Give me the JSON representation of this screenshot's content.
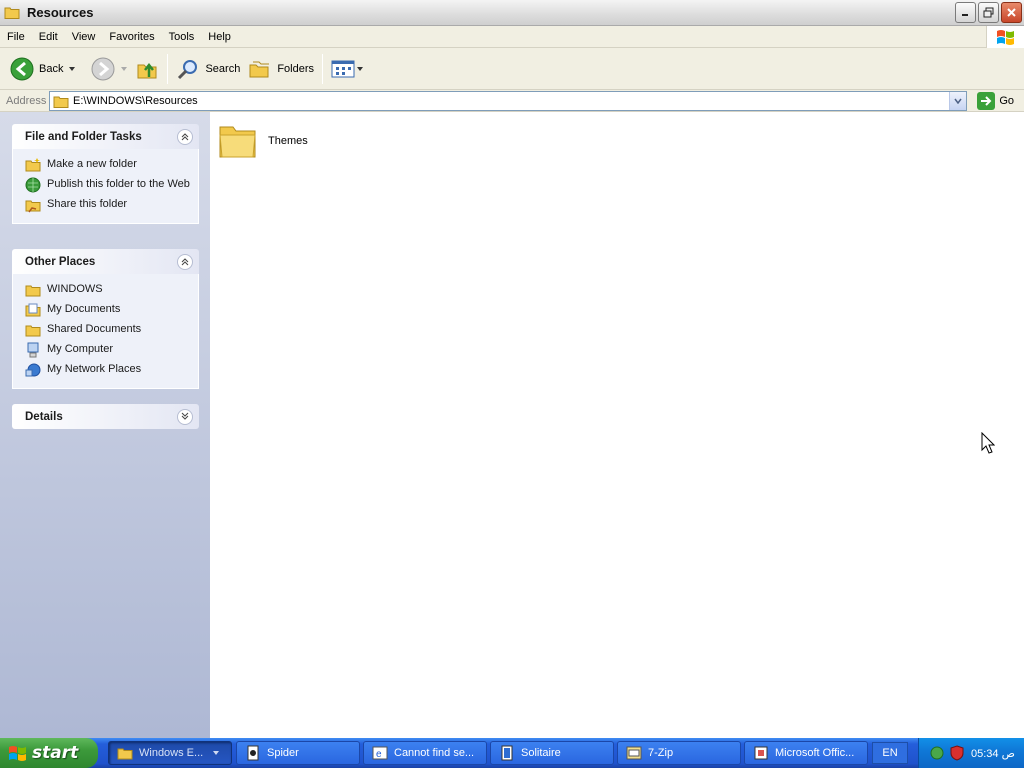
{
  "window": {
    "title": "Resources"
  },
  "menu": [
    "File",
    "Edit",
    "View",
    "Favorites",
    "Tools",
    "Help"
  ],
  "toolbar": {
    "back": "Back",
    "search": "Search",
    "folders": "Folders"
  },
  "address": {
    "label": "Address",
    "value": "E:\\WINDOWS\\Resources",
    "go": "Go"
  },
  "tasks_panel": {
    "title": "File and Folder Tasks",
    "items": [
      "Make a new folder",
      "Publish this folder to the Web",
      "Share this folder"
    ]
  },
  "places_panel": {
    "title": "Other Places",
    "items": [
      "WINDOWS",
      "My Documents",
      "Shared Documents",
      "My Computer",
      "My Network Places"
    ]
  },
  "details_panel": {
    "title": "Details"
  },
  "files": [
    {
      "name": "Themes",
      "icon": "folder-icon"
    }
  ],
  "taskbar": {
    "start": "start",
    "tasks": [
      "Windows E...",
      "Spider",
      "Cannot find se...",
      "Solitaire",
      "7-Zip",
      "Microsoft Offic..."
    ],
    "lang": "EN",
    "clock": "05:34 ص"
  }
}
